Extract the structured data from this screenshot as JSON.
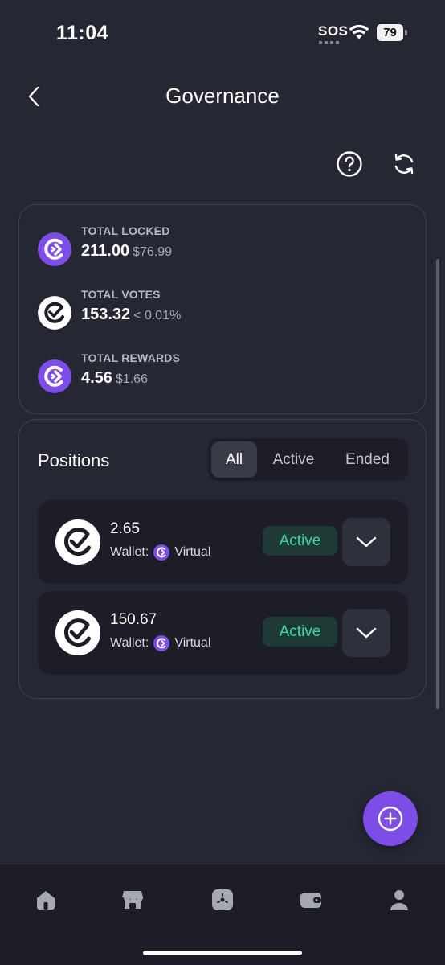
{
  "status_bar": {
    "time": "11:04",
    "sos": "SOS",
    "battery": "79"
  },
  "header": {
    "title": "Governance",
    "back_icon": "chevron-left-icon",
    "help_icon": "help-circle-icon",
    "refresh_icon": "refresh-icon"
  },
  "summary": {
    "items": [
      {
        "label": "TOTAL LOCKED",
        "value": "211.00",
        "sub": "$76.99",
        "icon": "purple-token-icon"
      },
      {
        "label": "TOTAL VOTES",
        "value": "153.32",
        "sub": "< 0.01%",
        "icon": "white-vote-token-icon"
      },
      {
        "label": "TOTAL REWARDS",
        "value": "4.56",
        "sub": "$1.66",
        "icon": "purple-token-icon"
      }
    ]
  },
  "positions": {
    "title": "Positions",
    "filters": [
      "All",
      "Active",
      "Ended"
    ],
    "selected_filter": "All",
    "items": [
      {
        "amount": "2.65",
        "wallet_label": "Wallet:",
        "wallet_name": "Virtual",
        "status": "Active"
      },
      {
        "amount": "150.67",
        "wallet_label": "Wallet:",
        "wallet_name": "Virtual",
        "status": "Active"
      }
    ]
  },
  "fab": {
    "icon": "plus-circle-icon"
  },
  "bottom_nav": {
    "items": [
      {
        "icon": "home-icon"
      },
      {
        "icon": "store-icon"
      },
      {
        "icon": "staking-icon"
      },
      {
        "icon": "wallet-icon"
      },
      {
        "icon": "profile-icon"
      }
    ]
  },
  "colors": {
    "background": "#252733",
    "card_inner": "#1c1d27",
    "accent_purple": "#7e4de8",
    "active_green": "#3dd69c",
    "active_badge_bg": "#1e3a36"
  }
}
